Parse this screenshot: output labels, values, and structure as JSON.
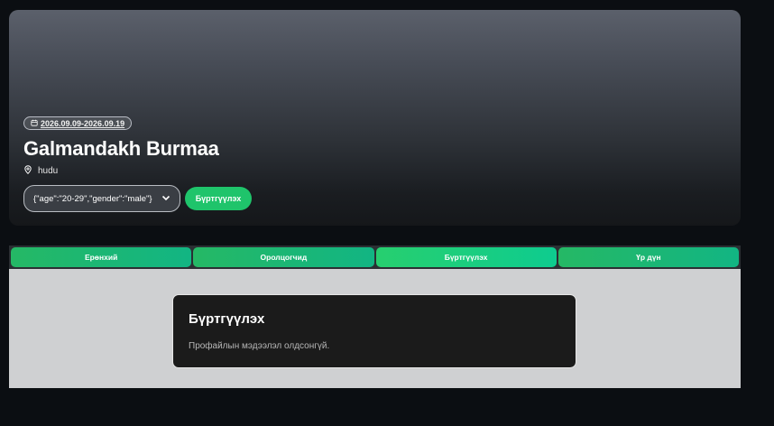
{
  "hero": {
    "date_range": "2026.09.09-2026.09.19",
    "title": "Galmandakh Burmaa",
    "location": "hudu",
    "select_value": "{\"age\":\"20-29\",\"gender\":\"male\"}",
    "register_label": "Бүртгүүлэх"
  },
  "tabs": [
    {
      "label": "Ерөнхий"
    },
    {
      "label": "Оролцогчид"
    },
    {
      "label": "Бүртгүүлэх"
    },
    {
      "label": "Үр дүн"
    }
  ],
  "active_tab": "Бүртгүүлэх",
  "card": {
    "title": "Бүртгүүлэх",
    "message": "Профайлын мэдээлэл олдсонгүй."
  },
  "colors": {
    "accent": "#1fc46b",
    "background": "#0b0e12",
    "panel": "#cfd0d2",
    "card": "#1b1b1b"
  },
  "icons": [
    "calendar-icon",
    "location-pin-icon",
    "chevron-down-icon"
  ]
}
